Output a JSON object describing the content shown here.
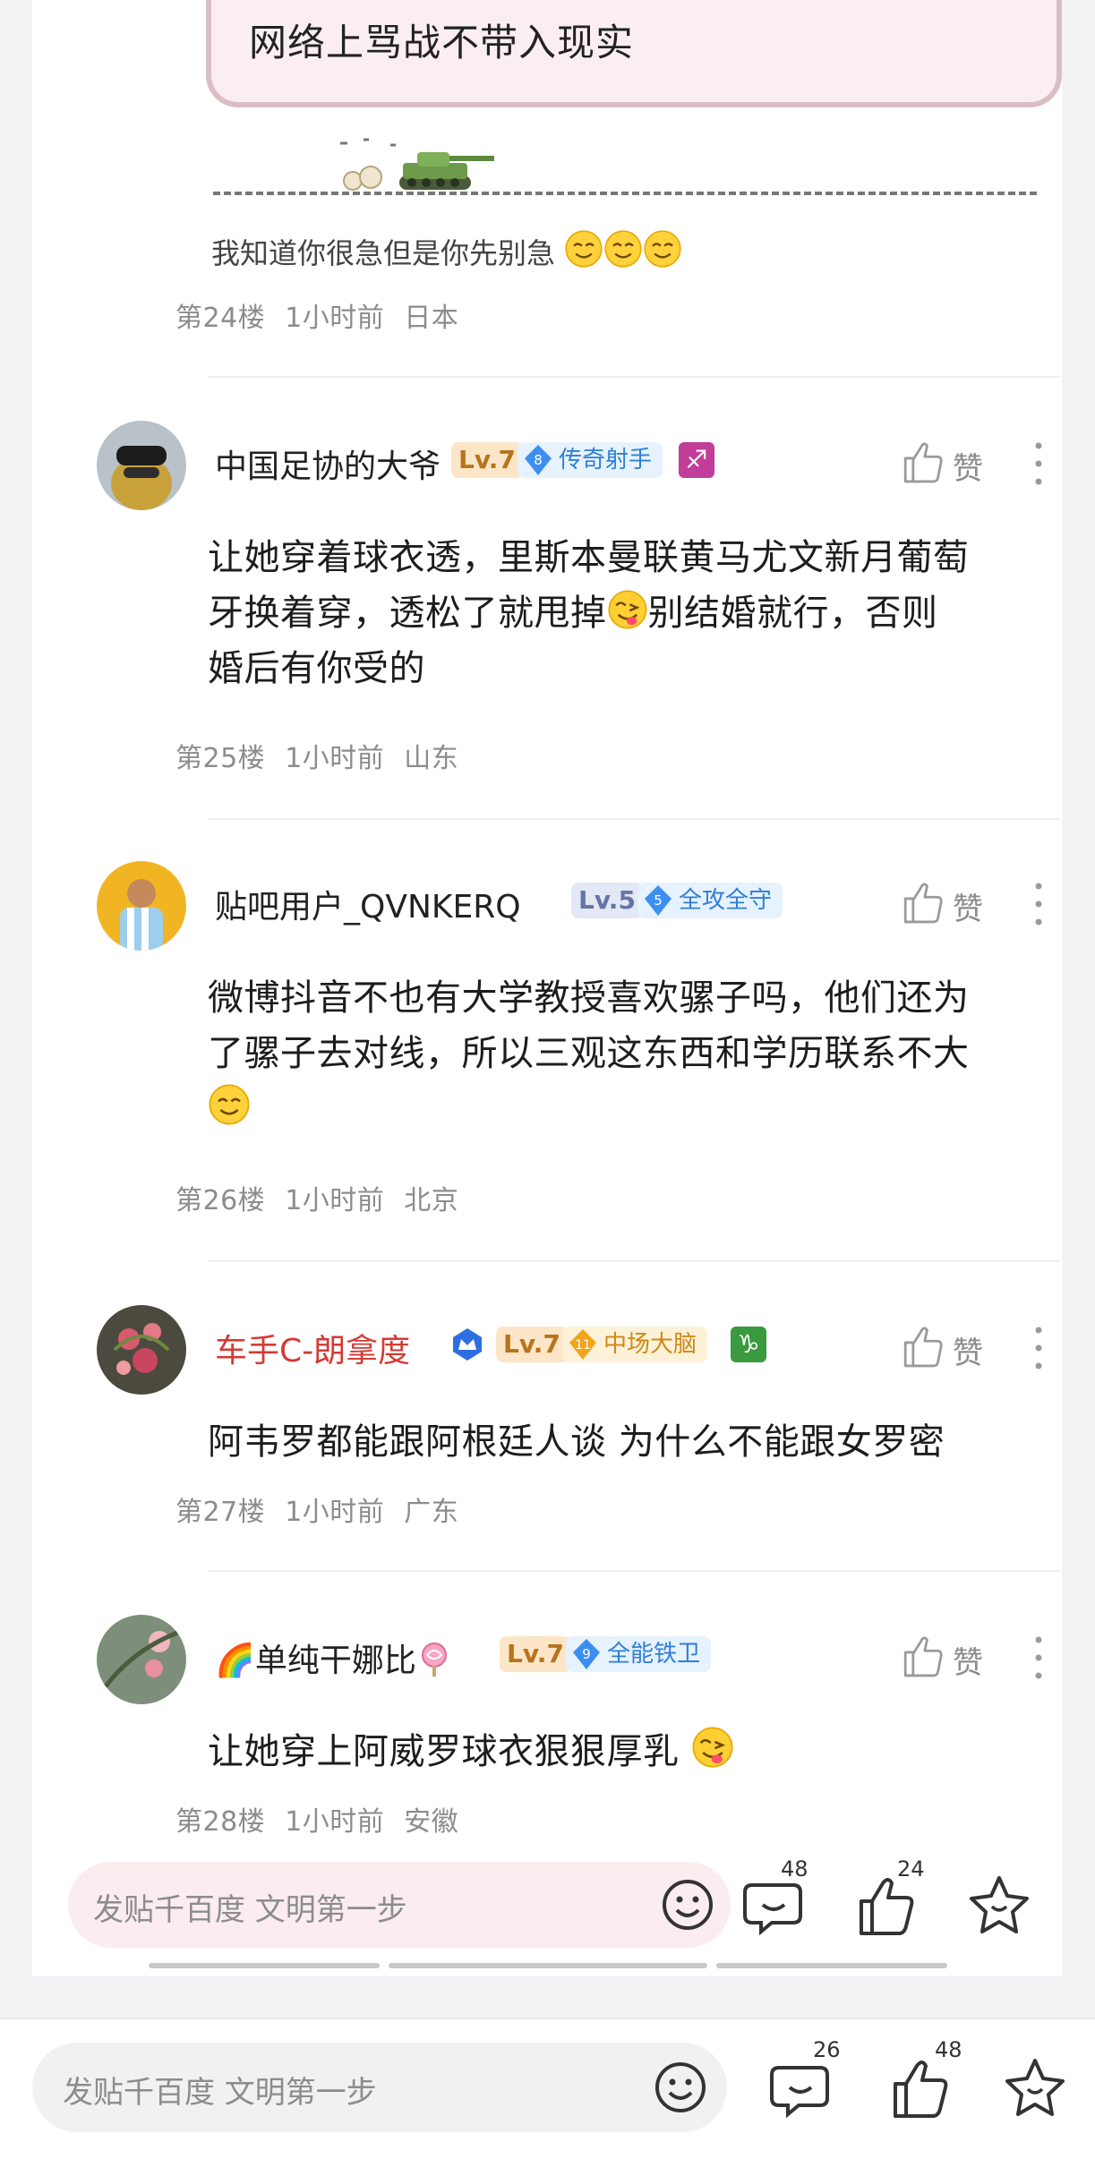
{
  "quote": {
    "text": "网络上骂战不带入现实"
  },
  "floor24": {
    "reply": "我知道你很急但是你先别急",
    "meta": {
      "floor": "第24楼",
      "time": "1小时前",
      "location": "日本"
    }
  },
  "like_label": "赞",
  "comments": [
    {
      "username": "中国足协的大爷",
      "level": "Lv.7",
      "badge_num": "8",
      "badge": "传奇射手",
      "zodiac": "♐",
      "text_lines": [
        "让她穿着球衣透，里斯本曼联黄马尤文新月葡萄",
        "牙换着穿，透松了就甩掉",
        "别结婚就行，否则",
        "婚后有你受的"
      ],
      "meta": {
        "floor": "第25楼",
        "time": "1小时前",
        "location": "山东"
      }
    },
    {
      "username": "贴吧用户_QVNKERQ",
      "level": "Lv.5",
      "badge_num": "5",
      "badge": "全攻全守",
      "text_lines": [
        "微博抖音不也有大学教授喜欢骡子吗，他们还为",
        "了骡子去对线，所以三观这东西和学历联系不大"
      ],
      "meta": {
        "floor": "第26楼",
        "time": "1小时前",
        "location": "北京"
      }
    },
    {
      "username": "车手C-朗拿度",
      "level": "Lv.7",
      "badge_num": "11",
      "badge": "中场大脑",
      "zodiac": "♑",
      "text_lines": [
        "阿韦罗都能跟阿根廷人谈 为什么不能跟女罗密"
      ],
      "meta": {
        "floor": "第27楼",
        "time": "1小时前",
        "location": "广东"
      }
    },
    {
      "username": "单纯干娜比",
      "username_prefix": "🌈",
      "level": "Lv.7",
      "badge_num": "9",
      "badge": "全能铁卫",
      "text_lines": [
        "让她穿上阿威罗球衣狠狠厚乳"
      ],
      "meta": {
        "floor": "第28楼",
        "time": "1小时前",
        "location": "安徽"
      }
    }
  ],
  "inner_bar": {
    "placeholder": "发贴千百度 文明第一步",
    "comments_count": "48",
    "likes_count": "24"
  },
  "outer_bar": {
    "placeholder": "发贴千百度 文明第一步",
    "comments_count": "26",
    "likes_count": "48"
  },
  "colors": {
    "accent_red": "#d33b35",
    "badge_blue": "#2f7fd8",
    "badge_gold": "#cc8a14",
    "level_orange": "#b8741c"
  }
}
